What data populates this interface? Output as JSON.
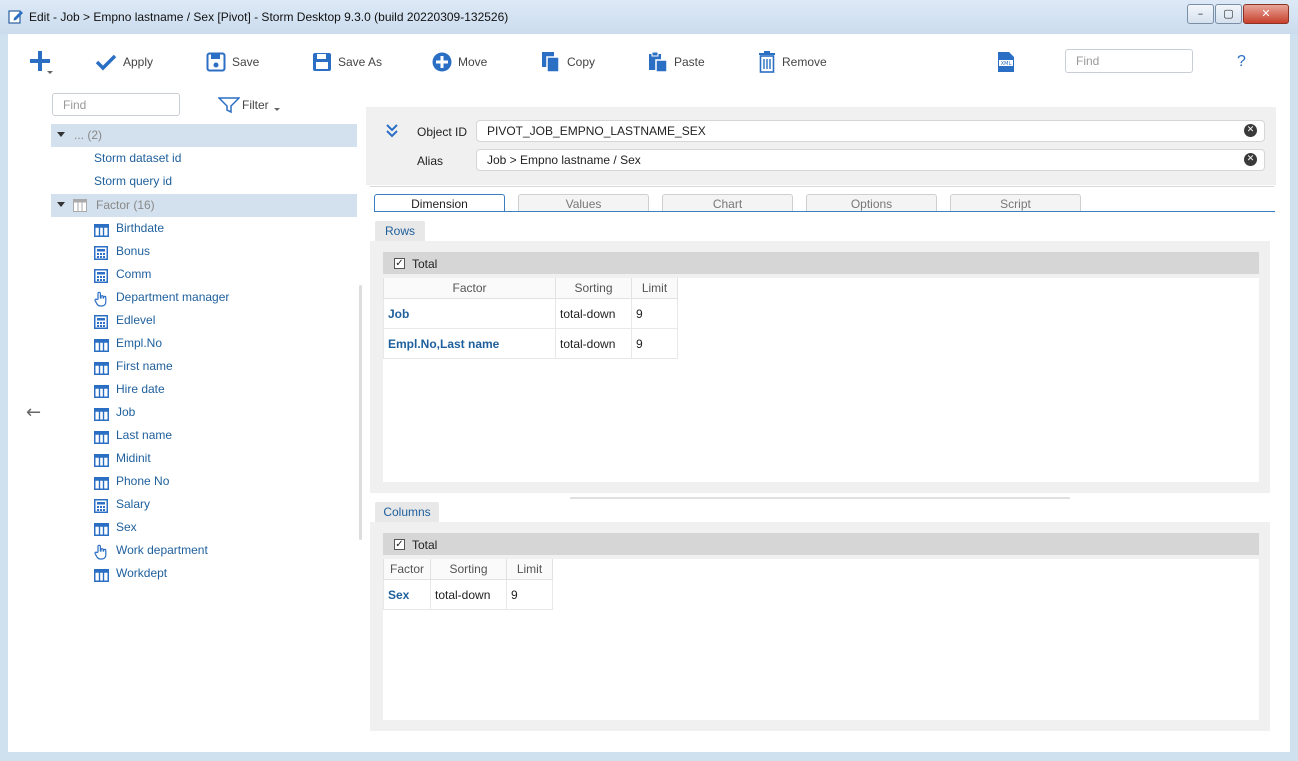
{
  "window": {
    "title": "Edit - Job > Empno lastname / Sex [Pivot] -  Storm Desktop 9.3.0 (build 20220309-132526)",
    "minimize_glyph": "–",
    "maximize_glyph": "▢",
    "close_glyph": "✕"
  },
  "toolbar": {
    "add_icon": "plus-icon",
    "apply": "Apply",
    "save": "Save",
    "save_as": "Save As",
    "move": "Move",
    "copy": "Copy",
    "paste": "Paste",
    "remove": "Remove",
    "export_icon": "xml-export-icon",
    "find_placeholder": "Find",
    "help": "?"
  },
  "left": {
    "find_placeholder": "Find",
    "filter_label": "Filter",
    "back_glyph": "←"
  },
  "tree": {
    "group1": {
      "label": "... (2)",
      "items": [
        "Storm dataset id",
        "Storm query id"
      ]
    },
    "group2": {
      "label": "Factor (16)",
      "items": [
        {
          "label": "Birthdate",
          "icon": "table-icon"
        },
        {
          "label": "Bonus",
          "icon": "calculator-icon"
        },
        {
          "label": "Comm",
          "icon": "calculator-icon"
        },
        {
          "label": "Department manager",
          "icon": "hand-pointer-icon"
        },
        {
          "label": "Edlevel",
          "icon": "calculator-icon"
        },
        {
          "label": "Empl.No",
          "icon": "table-icon"
        },
        {
          "label": "First name",
          "icon": "table-icon"
        },
        {
          "label": "Hire date",
          "icon": "table-icon"
        },
        {
          "label": "Job",
          "icon": "table-icon"
        },
        {
          "label": "Last name",
          "icon": "table-icon"
        },
        {
          "label": "Midinit",
          "icon": "table-icon"
        },
        {
          "label": "Phone No",
          "icon": "table-icon"
        },
        {
          "label": "Salary",
          "icon": "calculator-icon"
        },
        {
          "label": "Sex",
          "icon": "table-icon"
        },
        {
          "label": "Work department",
          "icon": "hand-pointer-icon"
        },
        {
          "label": "Workdept",
          "icon": "table-icon"
        }
      ]
    }
  },
  "object": {
    "id_label": "Object ID",
    "id_value": "PIVOT_JOB_EMPNO_LASTNAME_SEX",
    "alias_label": "Alias",
    "alias_value": "Job > Empno lastname / Sex",
    "clear_glyph": "✕"
  },
  "tabs": [
    "Dimension",
    "Values",
    "Chart",
    "Options",
    "Script"
  ],
  "rows": {
    "tab_label": "Rows",
    "total_label": "Total",
    "check_glyph": "✓",
    "headers": [
      "Factor",
      "Sorting",
      "Limit"
    ],
    "items": [
      {
        "factor": "Job",
        "sorting": "total-down",
        "limit": "9"
      },
      {
        "factor": "Empl.No,Last name",
        "sorting": "total-down",
        "limit": "9"
      }
    ]
  },
  "columns": {
    "tab_label": "Columns",
    "total_label": "Total",
    "check_glyph": "✓",
    "headers": [
      "Factor",
      "Sorting",
      "Limit"
    ],
    "items": [
      {
        "factor": "Sex",
        "sorting": "total-down",
        "limit": "9"
      }
    ]
  }
}
